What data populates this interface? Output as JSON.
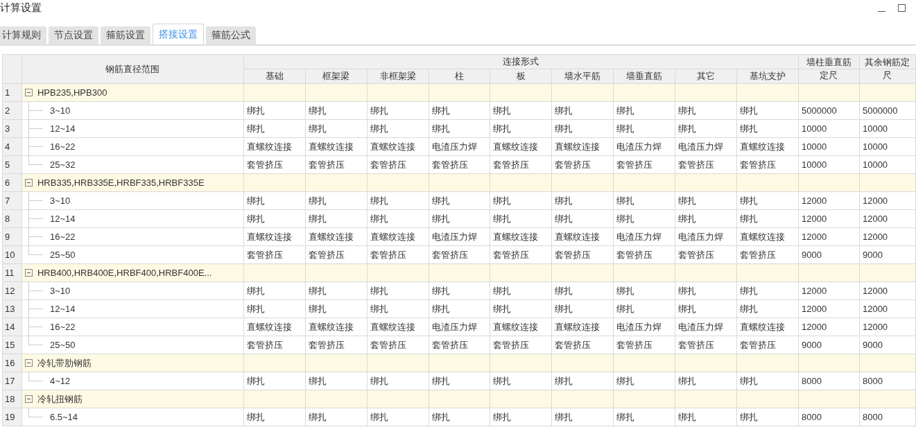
{
  "window": {
    "title": "计算设置"
  },
  "tabs": [
    {
      "label": "计算规则",
      "selected": false
    },
    {
      "label": "节点设置",
      "selected": false
    },
    {
      "label": "箍筋设置",
      "selected": false
    },
    {
      "label": "搭接设置",
      "selected": true
    },
    {
      "label": "箍筋公式",
      "selected": false
    }
  ],
  "table": {
    "range_header": "钢筋直径范围",
    "group_header": "连接形式",
    "sub_columns": [
      "基础",
      "框架梁",
      "非框架梁",
      "柱",
      "板",
      "墙水平筋",
      "墙垂直筋",
      "其它",
      "基坑支护"
    ],
    "extra_columns": [
      [
        "墙柱垂直筋",
        "定尺"
      ],
      [
        "其余钢筋定",
        "尺"
      ]
    ],
    "groups": [
      {
        "number": "1",
        "name": "HPB235,HPB300",
        "expanded": true,
        "rows": [
          {
            "number": "2",
            "range": "3~10",
            "cells": [
              "绑扎",
              "绑扎",
              "绑扎",
              "绑扎",
              "绑扎",
              "绑扎",
              "绑扎",
              "绑扎",
              "绑扎",
              "5000000",
              "5000000"
            ]
          },
          {
            "number": "3",
            "range": "12~14",
            "cells": [
              "绑扎",
              "绑扎",
              "绑扎",
              "绑扎",
              "绑扎",
              "绑扎",
              "绑扎",
              "绑扎",
              "绑扎",
              "10000",
              "10000"
            ]
          },
          {
            "number": "4",
            "range": "16~22",
            "cells": [
              "直螺纹连接",
              "直螺纹连接",
              "直螺纹连接",
              "电渣压力焊",
              "直螺纹连接",
              "直螺纹连接",
              "电渣压力焊",
              "电渣压力焊",
              "直螺纹连接",
              "10000",
              "10000"
            ]
          },
          {
            "number": "5",
            "range": "25~32",
            "cells": [
              "套管挤压",
              "套管挤压",
              "套管挤压",
              "套管挤压",
              "套管挤压",
              "套管挤压",
              "套管挤压",
              "套管挤压",
              "套管挤压",
              "10000",
              "10000"
            ]
          }
        ]
      },
      {
        "number": "6",
        "name": "HRB335,HRB335E,HRBF335,HRBF335E",
        "expanded": true,
        "rows": [
          {
            "number": "7",
            "range": "3~10",
            "cells": [
              "绑扎",
              "绑扎",
              "绑扎",
              "绑扎",
              "绑扎",
              "绑扎",
              "绑扎",
              "绑扎",
              "绑扎",
              "12000",
              "12000"
            ]
          },
          {
            "number": "8",
            "range": "12~14",
            "cells": [
              "绑扎",
              "绑扎",
              "绑扎",
              "绑扎",
              "绑扎",
              "绑扎",
              "绑扎",
              "绑扎",
              "绑扎",
              "12000",
              "12000"
            ]
          },
          {
            "number": "9",
            "range": "16~22",
            "cells": [
              "直螺纹连接",
              "直螺纹连接",
              "直螺纹连接",
              "电渣压力焊",
              "直螺纹连接",
              "直螺纹连接",
              "电渣压力焊",
              "电渣压力焊",
              "直螺纹连接",
              "12000",
              "12000"
            ]
          },
          {
            "number": "10",
            "range": "25~50",
            "cells": [
              "套管挤压",
              "套管挤压",
              "套管挤压",
              "套管挤压",
              "套管挤压",
              "套管挤压",
              "套管挤压",
              "套管挤压",
              "套管挤压",
              "9000",
              "9000"
            ]
          }
        ]
      },
      {
        "number": "11",
        "name": "HRB400,HRB400E,HRBF400,HRBF400E...",
        "expanded": true,
        "rows": [
          {
            "number": "12",
            "range": "3~10",
            "cells": [
              "绑扎",
              "绑扎",
              "绑扎",
              "绑扎",
              "绑扎",
              "绑扎",
              "绑扎",
              "绑扎",
              "绑扎",
              "12000",
              "12000"
            ]
          },
          {
            "number": "13",
            "range": "12~14",
            "cells": [
              "绑扎",
              "绑扎",
              "绑扎",
              "绑扎",
              "绑扎",
              "绑扎",
              "绑扎",
              "绑扎",
              "绑扎",
              "12000",
              "12000"
            ]
          },
          {
            "number": "14",
            "range": "16~22",
            "cells": [
              "直螺纹连接",
              "直螺纹连接",
              "直螺纹连接",
              "电渣压力焊",
              "直螺纹连接",
              "直螺纹连接",
              "电渣压力焊",
              "电渣压力焊",
              "直螺纹连接",
              "12000",
              "12000"
            ]
          },
          {
            "number": "15",
            "range": "25~50",
            "cells": [
              "套管挤压",
              "套管挤压",
              "套管挤压",
              "套管挤压",
              "套管挤压",
              "套管挤压",
              "套管挤压",
              "套管挤压",
              "套管挤压",
              "9000",
              "9000"
            ]
          }
        ]
      },
      {
        "number": "16",
        "name": "冷轧带肋钢筋",
        "expanded": true,
        "rows": [
          {
            "number": "17",
            "range": "4~12",
            "cells": [
              "绑扎",
              "绑扎",
              "绑扎",
              "绑扎",
              "绑扎",
              "绑扎",
              "绑扎",
              "绑扎",
              "绑扎",
              "8000",
              "8000"
            ]
          }
        ]
      },
      {
        "number": "18",
        "name": "冷轧扭钢筋",
        "expanded": true,
        "rows": [
          {
            "number": "19",
            "range": "6.5~14",
            "cells": [
              "绑扎",
              "绑扎",
              "绑扎",
              "绑扎",
              "绑扎",
              "绑扎",
              "绑扎",
              "绑扎",
              "绑扎",
              "8000",
              "8000"
            ]
          }
        ]
      }
    ]
  }
}
